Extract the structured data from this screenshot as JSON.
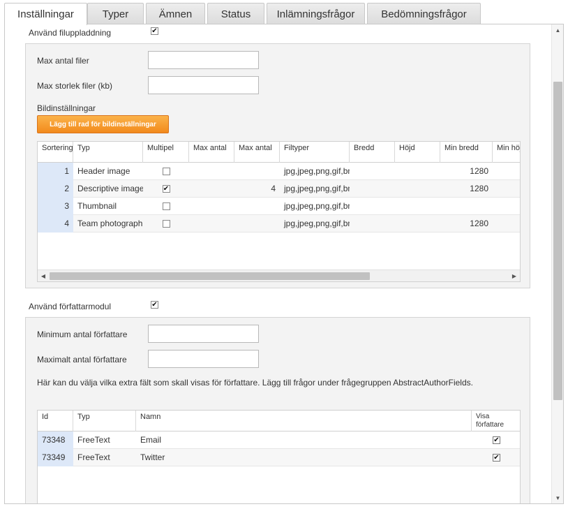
{
  "tabs": [
    "Inställningar",
    "Typer",
    "Ämnen",
    "Status",
    "Inlämningsfrågor",
    "Bedömningsfrågor"
  ],
  "file_upload": {
    "label": "Använd filuppladdning",
    "checked_mark": "✔",
    "max_files_label": "Max antal filer",
    "max_files_value": "",
    "max_size_label": "Max storlek filer (kb)",
    "max_size_value": "",
    "image_settings_label": "Bildinställningar",
    "add_row_button": "Lägg till rad för bildinställningar",
    "grid": {
      "headers": [
        "Sortering",
        "Typ",
        "Multipel",
        "Max antal",
        "Max antal",
        "Filtyper",
        "Bredd",
        "Höjd",
        "Min bredd",
        "Min höjd"
      ],
      "rows": [
        {
          "sort": "1",
          "type": "Header image",
          "multiple": false,
          "max1": "",
          "max2": "",
          "filetypes": "jpg,jpeg,png,gif,bmp",
          "width": "",
          "height": "",
          "min_width": "1280",
          "min_height": ""
        },
        {
          "sort": "2",
          "type": "Descriptive image",
          "multiple": true,
          "max1": "",
          "max2": "4",
          "filetypes": "jpg,jpeg,png,gif,bmp",
          "width": "",
          "height": "",
          "min_width": "1280",
          "min_height": ""
        },
        {
          "sort": "3",
          "type": "Thumbnail",
          "multiple": false,
          "max1": "",
          "max2": "",
          "filetypes": "jpg,jpeg,png,gif,bmp",
          "width": "",
          "height": "",
          "min_width": "",
          "min_height": ""
        },
        {
          "sort": "4",
          "type": "Team photograph",
          "multiple": false,
          "max1": "",
          "max2": "",
          "filetypes": "jpg,jpeg,png,gif,bmp",
          "width": "",
          "height": "",
          "min_width": "1280",
          "min_height": ""
        }
      ]
    }
  },
  "author_module": {
    "label": "Använd författarmodul",
    "min_authors_label": "Minimum antal författare",
    "min_authors_value": "",
    "max_authors_label": "Maximalt antal författare",
    "max_authors_value": "",
    "help_text": "Här kan du välja vilka extra fält som skall visas för författare. Lägg till frågor under frågegruppen AbstractAuthorFields.",
    "grid": {
      "headers": [
        "Id",
        "Typ",
        "Namn",
        "Visa författare"
      ],
      "rows": [
        {
          "id": "73348",
          "type": "FreeText",
          "name": "Email",
          "show": true
        },
        {
          "id": "73349",
          "type": "FreeText",
          "name": "Twitter",
          "show": true
        }
      ]
    }
  },
  "icons": {
    "scroll_up": "▲",
    "scroll_down": "▼",
    "scroll_left": "◀",
    "scroll_right": "▶"
  }
}
